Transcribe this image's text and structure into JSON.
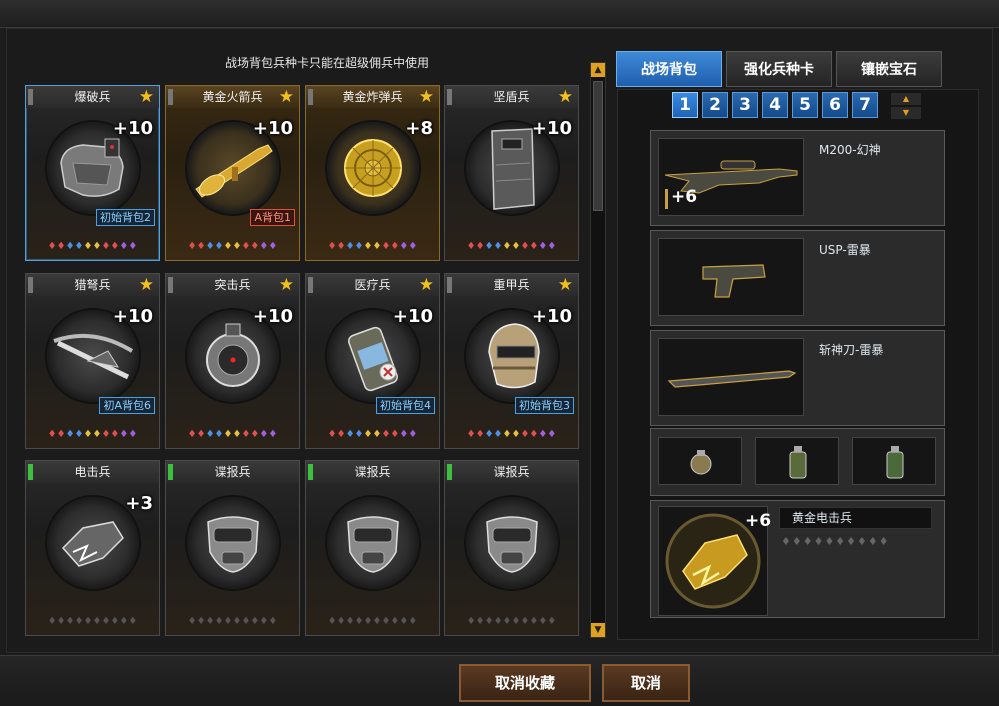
{
  "hint": "战场背包兵种卡只能在超级佣兵中使用",
  "cards": [
    {
      "name": "爆破兵",
      "level": "+10",
      "pack": "初始背包2",
      "pack_color": "blue",
      "icon": "c4-backpack-icon",
      "bar": "gray",
      "gold": false,
      "selected": true
    },
    {
      "name": "黄金火箭兵",
      "level": "+10",
      "pack": "A背包1",
      "pack_color": "red",
      "icon": "golden-rpg-icon",
      "bar": "gray",
      "gold": true,
      "selected": false
    },
    {
      "name": "黄金炸弹兵",
      "level": "+8",
      "pack": "",
      "pack_color": "",
      "icon": "golden-bomb-icon",
      "bar": "gray",
      "gold": true,
      "selected": false
    },
    {
      "name": "坚盾兵",
      "level": "+10",
      "pack": "",
      "pack_color": "",
      "icon": "riot-shield-icon",
      "bar": "gray",
      "gold": false,
      "selected": false
    },
    {
      "name": "猎弩兵",
      "level": "+10",
      "pack": "初A背包6",
      "pack_color": "blue",
      "icon": "crossbow-icon",
      "bar": "gray",
      "gold": false,
      "selected": false
    },
    {
      "name": "突击兵",
      "level": "+10",
      "pack": "",
      "pack_color": "",
      "icon": "sight-device-icon",
      "bar": "gray",
      "gold": false,
      "selected": false
    },
    {
      "name": "医疗兵",
      "level": "+10",
      "pack": "初始背包4",
      "pack_color": "blue",
      "icon": "medkit-canister-icon",
      "bar": "gray",
      "gold": false,
      "selected": false
    },
    {
      "name": "重甲兵",
      "level": "+10",
      "pack": "初始背包3",
      "pack_color": "blue",
      "icon": "armor-helmet-icon",
      "bar": "gray",
      "gold": false,
      "selected": false
    },
    {
      "name": "电击兵",
      "level": "+3",
      "pack": "",
      "pack_color": "",
      "icon": "shock-gauntlet-icon",
      "bar": "green",
      "gold": false,
      "selected": false
    },
    {
      "name": "谍报兵",
      "level": "",
      "pack": "",
      "pack_color": "",
      "icon": "spy-mask-icon",
      "bar": "green",
      "gold": false,
      "selected": false
    },
    {
      "name": "谍报兵",
      "level": "",
      "pack": "",
      "pack_color": "",
      "icon": "spy-mask-icon",
      "bar": "green",
      "gold": false,
      "selected": false
    },
    {
      "name": "谍报兵",
      "level": "",
      "pack": "",
      "pack_color": "",
      "icon": "spy-mask-icon",
      "bar": "green",
      "gold": false,
      "selected": false
    }
  ],
  "tabs": [
    "战场背包",
    "强化兵种卡",
    "镶嵌宝石"
  ],
  "pages": [
    "1",
    "2",
    "3",
    "4",
    "5",
    "6",
    "7"
  ],
  "slots": [
    {
      "name": "M200-幻神",
      "plus": "+6"
    },
    {
      "name": "USP-雷暴",
      "plus": ""
    },
    {
      "name": "斩神刀-雷暴",
      "plus": ""
    }
  ],
  "character": {
    "name": "黄金电击兵",
    "plus": "+6"
  },
  "buttons": {
    "unfavorite": "取消收藏",
    "cancel": "取消"
  },
  "colors": {
    "accent_blue": "#2a6ab0",
    "gold_star": "#f2c01c",
    "button_brown": "#5a3a22"
  }
}
